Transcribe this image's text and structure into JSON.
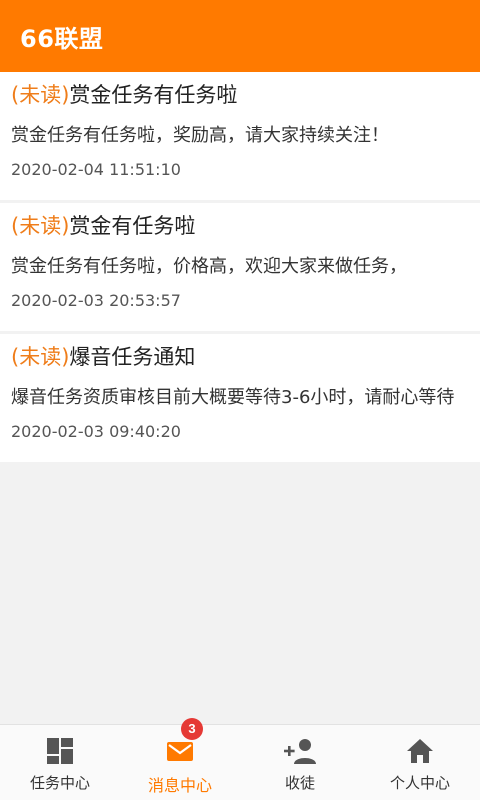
{
  "header": {
    "title": "66联盟"
  },
  "messages": [
    {
      "status": "(未读)",
      "title": "赏金任务有任务啦",
      "content": "赏金任务有任务啦，奖励高，请大家持续关注！",
      "time": "2020-02-04 11:51:10"
    },
    {
      "status": "(未读)",
      "title": "赏金有任务啦",
      "content": "赏金任务有任务啦，价格高，欢迎大家来做任务，",
      "time": "2020-02-03 20:53:57"
    },
    {
      "status": "(未读)",
      "title": "爆音任务通知",
      "content": "爆音任务资质审核目前大概要等待3-6小时，请耐心等待",
      "time": "2020-02-03 09:40:20"
    }
  ],
  "tabbar": {
    "items": [
      {
        "label": "任务中心",
        "icon": "dashboard-icon"
      },
      {
        "label": "消息中心",
        "icon": "mail-icon",
        "badge": "3",
        "active": true
      },
      {
        "label": "收徒",
        "icon": "add-person-icon"
      },
      {
        "label": "个人中心",
        "icon": "home-icon"
      }
    ]
  },
  "colors": {
    "accent": "#ff7a00",
    "unread": "#ef7d1a",
    "badge": "#e53935"
  }
}
